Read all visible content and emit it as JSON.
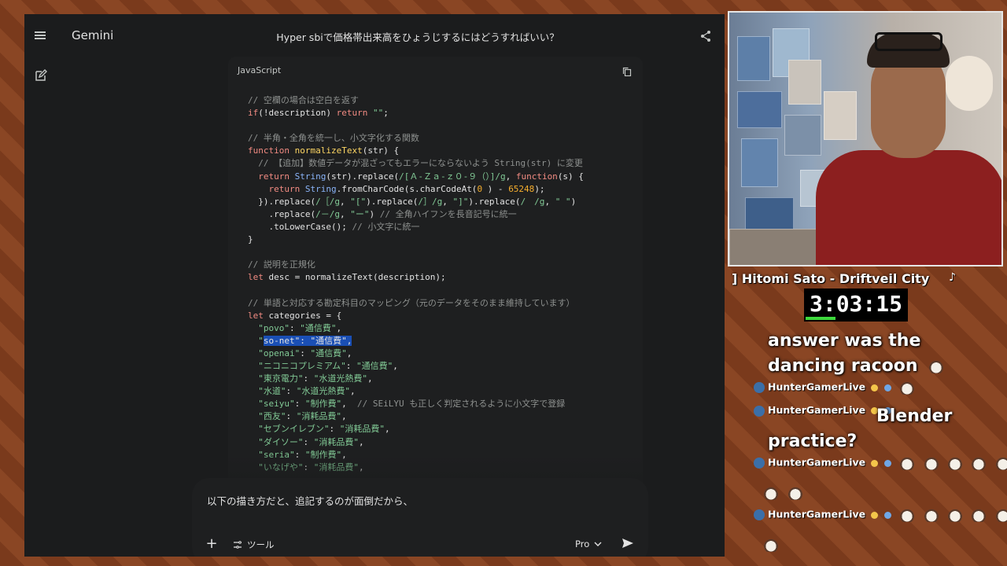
{
  "gemini": {
    "app_name": "Gemini",
    "conversation_title": "Hyper sbiで価格帯出来高をひょうじするにはどうすればいい？",
    "code_language": "JavaScript",
    "code_lines": [
      [
        [
          "c-com",
          "// 空欄の場合は空白を返す"
        ]
      ],
      [
        [
          "c-kw",
          "if"
        ],
        [
          "",
          "(!description) "
        ],
        [
          "c-kw",
          "return"
        ],
        [
          "c-str",
          " \"\""
        ],
        [
          "",
          ";"
        ]
      ],
      [],
      [
        [
          "c-com",
          "// 半角・全角を統一し、小文字化する関数"
        ]
      ],
      [
        [
          "c-kw",
          "function"
        ],
        [
          "",
          " "
        ],
        [
          "c-fn",
          "normalizeText"
        ],
        [
          "",
          "(str) {"
        ]
      ],
      [
        [
          "",
          "  "
        ],
        [
          "c-com",
          "// 【追加】数値データが混ざってもエラーにならないよう String(str) に変更"
        ]
      ],
      [
        [
          "",
          "  "
        ],
        [
          "c-kw",
          "return"
        ],
        [
          "",
          " "
        ],
        [
          "c-blue",
          "String"
        ],
        [
          "",
          "(str).replace("
        ],
        [
          "c-str",
          "/[Ａ-Ｚａ-ｚ０-９（）]/g"
        ],
        [
          "",
          ", "
        ],
        [
          "c-kw",
          "function"
        ],
        [
          "",
          "(s) {"
        ]
      ],
      [
        [
          "",
          "    "
        ],
        [
          "c-kw",
          "return"
        ],
        [
          "",
          " "
        ],
        [
          "c-blue",
          "String"
        ],
        [
          "",
          ".fromCharCode(s.charCodeAt("
        ],
        [
          "c-num",
          "0"
        ],
        [
          "",
          " ) - "
        ],
        [
          "c-num",
          "65248"
        ],
        [
          "",
          ");"
        ]
      ],
      [
        [
          "",
          "  }).replace("
        ],
        [
          "c-str",
          "/［/g"
        ],
        [
          "",
          ", "
        ],
        [
          "c-str",
          "\"[\""
        ],
        [
          "",
          ").replace("
        ],
        [
          "c-str",
          "/］/g"
        ],
        [
          "",
          ", "
        ],
        [
          "c-str",
          "\"]\""
        ],
        [
          "",
          ").replace("
        ],
        [
          "c-str",
          "/　/g"
        ],
        [
          "",
          ", "
        ],
        [
          "c-str",
          "\" \""
        ],
        [
          "",
          ")"
        ]
      ],
      [
        [
          "",
          "    .replace("
        ],
        [
          "c-str",
          "/－/g"
        ],
        [
          "",
          ", "
        ],
        [
          "c-str",
          "\"ー\""
        ],
        [
          "",
          ") "
        ],
        [
          "c-com",
          "// 全角ハイフンを長音記号に統一"
        ]
      ],
      [
        [
          "",
          "    .toLowerCase(); "
        ],
        [
          "c-com",
          "// 小文字に統一"
        ]
      ],
      [
        [
          "",
          "}"
        ]
      ],
      [],
      [
        [
          "c-com",
          "// 説明を正規化"
        ]
      ],
      [
        [
          "c-kw",
          "let"
        ],
        [
          "",
          " desc = normalizeText(description);"
        ]
      ],
      [],
      [
        [
          "c-com",
          "// 単語と対応する勘定科目のマッピング（元のデータをそのまま維持しています）"
        ]
      ],
      [
        [
          "c-kw",
          "let"
        ],
        [
          "",
          " categories = {"
        ]
      ],
      [
        [
          "",
          "  "
        ],
        [
          "c-str",
          "\"povo\""
        ],
        [
          "",
          ": "
        ],
        [
          "c-str",
          "\"通信費\""
        ],
        [
          "",
          ","
        ]
      ],
      [
        [
          "",
          "  "
        ],
        [
          "c-str",
          "\""
        ],
        [
          "sel",
          "so-net\": \"通信費\","
        ]
      ],
      [
        [
          "",
          "  "
        ],
        [
          "c-str",
          "\"openai\""
        ],
        [
          "",
          ": "
        ],
        [
          "c-str",
          "\"通信費\""
        ],
        [
          "",
          ","
        ]
      ],
      [
        [
          "",
          "  "
        ],
        [
          "c-str",
          "\"ニコニコプレミアム\""
        ],
        [
          "",
          ": "
        ],
        [
          "c-str",
          "\"通信費\""
        ],
        [
          "",
          ","
        ]
      ],
      [
        [
          "",
          "  "
        ],
        [
          "c-str",
          "\"東京電力\""
        ],
        [
          "",
          ": "
        ],
        [
          "c-str",
          "\"水道光熱費\""
        ],
        [
          "",
          ","
        ]
      ],
      [
        [
          "",
          "  "
        ],
        [
          "c-str",
          "\"水道\""
        ],
        [
          "",
          ": "
        ],
        [
          "c-str",
          "\"水道光熱費\""
        ],
        [
          "",
          ","
        ]
      ],
      [
        [
          "",
          "  "
        ],
        [
          "c-str",
          "\"seiyu\""
        ],
        [
          "",
          ": "
        ],
        [
          "c-str",
          "\"制作費\""
        ],
        [
          "",
          ",  "
        ],
        [
          "c-com",
          "// SEiLYU も正しく判定されるように小文字で登録"
        ]
      ],
      [
        [
          "",
          "  "
        ],
        [
          "c-str",
          "\"西友\""
        ],
        [
          "",
          ": "
        ],
        [
          "c-str",
          "\"消耗品費\""
        ],
        [
          "",
          ","
        ]
      ],
      [
        [
          "",
          "  "
        ],
        [
          "c-str",
          "\"セブンイレブン\""
        ],
        [
          "",
          ": "
        ],
        [
          "c-str",
          "\"消耗品費\""
        ],
        [
          "",
          ","
        ]
      ],
      [
        [
          "",
          "  "
        ],
        [
          "c-str",
          "\"ダイソー\""
        ],
        [
          "",
          ": "
        ],
        [
          "c-str",
          "\"消耗品費\""
        ],
        [
          "",
          ","
        ]
      ],
      [
        [
          "",
          "  "
        ],
        [
          "c-str",
          "\"seria\""
        ],
        [
          "",
          ": "
        ],
        [
          "c-str",
          "\"制作費\""
        ],
        [
          "",
          ","
        ]
      ],
      [
        [
          "",
          "  "
        ],
        [
          "c-str",
          "\"いなげや\""
        ],
        [
          "",
          ": "
        ],
        [
          "c-str",
          "\"消耗品費\""
        ],
        [
          "",
          ","
        ]
      ]
    ],
    "prompt_text": "以下の描き方だと、追記するのが面倒だから、",
    "plus_label": "+",
    "tools_label": "ツール",
    "model_label": "Pro"
  },
  "stream": {
    "now_playing": "] Hitomi Sato - Driftveil City",
    "timer": "3:03:15",
    "timer_progress": 0.29,
    "chat": {
      "first_message": "answer was the dancing racoon",
      "rows": [
        {
          "user": "HunterGamerLive",
          "message": ""
        },
        {
          "user": "HunterGamerLive",
          "message": "Blender practice?"
        },
        {
          "user": "HunterGamerLive",
          "message": ""
        },
        {
          "user": "HunterGamerLive",
          "message": ""
        }
      ]
    }
  },
  "colors": {
    "gemini_bg": "#1b1c1d",
    "code_bg": "#1e1f20",
    "selection": "#1a4fb5",
    "timer_bar": "#3cd83c"
  }
}
